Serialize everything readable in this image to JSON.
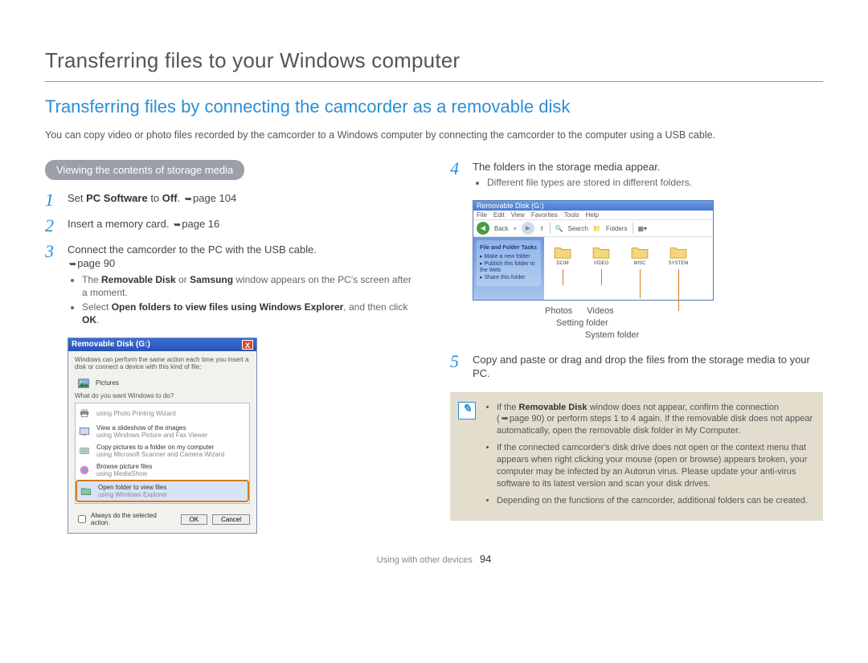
{
  "header": {
    "title": "Transferring files to your Windows computer"
  },
  "section": {
    "heading": "Transferring files by connecting the camcorder as a removable disk",
    "intro": "You can copy video or photo files recorded by the camcorder to a Windows computer by connecting the camcorder to the computer using a USB cable."
  },
  "pill": "Viewing the contents of storage media",
  "steps": {
    "s1": {
      "num": "1",
      "pre": "Set ",
      "bold": "PC Software",
      "mid": " to ",
      "bold2": "Off",
      "post": ". ",
      "ref": "page 104"
    },
    "s2": {
      "num": "2",
      "text": "Insert a memory card. ",
      "ref": "page 16"
    },
    "s3": {
      "num": "3",
      "text": "Connect the camcorder to the PC with the USB cable.",
      "ref": "page 90",
      "b1_pre": "The ",
      "b1_bold1": "Removable Disk",
      "b1_mid": " or ",
      "b1_bold2": "Samsung",
      "b1_post": " window appears on the PC's screen after a moment.",
      "b2_pre": "Select ",
      "b2_bold1": "Open folders to view files using Windows Explorer",
      "b2_mid": ", and then click ",
      "b2_bold2": "OK",
      "b2_post": "."
    },
    "s4": {
      "num": "4",
      "text": "The folders in the storage media appear.",
      "b1": "Different file types are stored in different folders."
    },
    "s5": {
      "num": "5",
      "text": "Copy and paste or drag and drop the files from the storage media to your PC."
    }
  },
  "dialog": {
    "title": "Removable Disk (G:)",
    "close": "X",
    "line1": "Windows can perform the same action each time you insert a disk or connect a device with this kind of file:",
    "icon_label": "Pictures",
    "prompt": "What do you want Windows to do?",
    "opt1a": "using Photo Printing Wizard",
    "opt2a": "View a slideshow of the images",
    "opt2b": "using Windows Picture and Fax Viewer",
    "opt3a": "Copy pictures to a folder on my computer",
    "opt3b": "using Microsoft Scanner and Camera Wizard",
    "opt4a": "Browse picture files",
    "opt4b": "using MediaShow",
    "opt5a": "Open folder to view files",
    "opt5b": "using Windows Explorer",
    "chk": "Always do the selected action.",
    "ok": "OK",
    "cancel": "Cancel"
  },
  "explorer": {
    "title": "Removable Disk (G:)",
    "menu": {
      "file": "File",
      "edit": "Edit",
      "view": "View",
      "fav": "Favorites",
      "tools": "Tools",
      "help": "Help"
    },
    "toolbar": {
      "back": "Back",
      "search": "Search",
      "folders": "Folders"
    },
    "side": {
      "heading": "File and Folder Tasks",
      "t1": "Make a new folder",
      "t2": "Publish this folder to the Web",
      "t3": "Share this folder"
    },
    "folders": {
      "f1": "DCIM",
      "f2": "VIDEO",
      "f3": "MISC",
      "f4": "SYSTEM"
    }
  },
  "callouts": {
    "photos": "Photos",
    "videos": "Videos",
    "setting": "Setting folder",
    "system": "System folder"
  },
  "note": {
    "n1_pre": "If the ",
    "n1_bold": "Removable Disk",
    "n1_post": " window does not appear, confirm the connection (",
    "n1_ref": "page 90",
    "n1_tail": ") or perform steps 1 to 4 again. If the removable disk does not appear automatically, open the removable disk folder in My Computer.",
    "n2": "If the connected camcorder's disk drive does not open or the context menu that appears when right clicking your mouse (open or browse) appears broken, your computer may be infected by an Autorun virus. Please update your anti-virus software to its latest version and scan your disk drives.",
    "n3": "Depending on the functions of the camcorder, additional folders can be created."
  },
  "footer": {
    "section": "Using with other devices",
    "page": "94"
  }
}
